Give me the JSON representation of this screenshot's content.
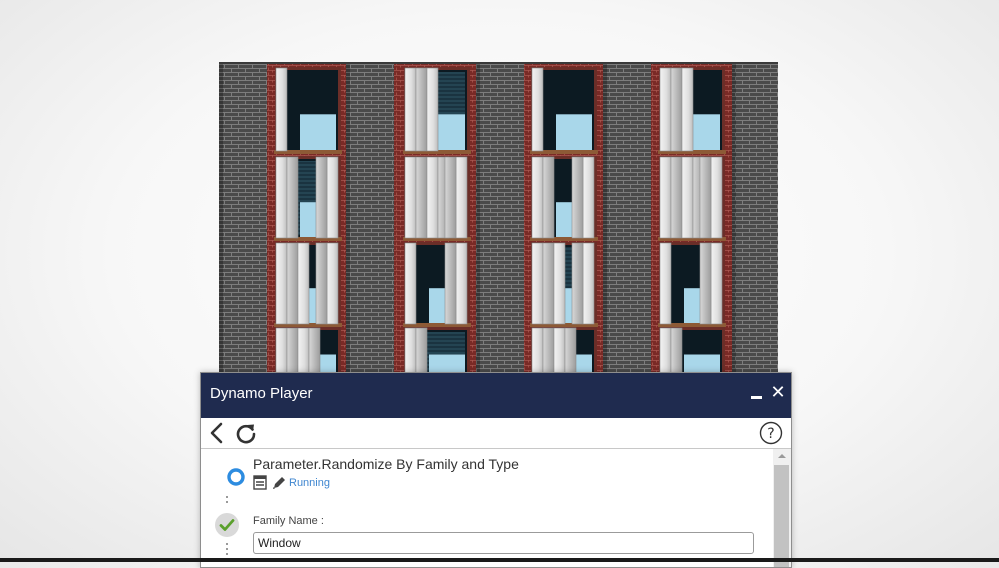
{
  "player": {
    "title": "Dynamo Player",
    "script": {
      "name": "Parameter.Randomize By Family and Type",
      "status": "Running"
    },
    "inputs": {
      "family_name_label": "Family Name :",
      "family_name_value": "Window"
    }
  },
  "icons": {
    "back": "chevron-left-icon",
    "refresh": "refresh-icon",
    "help": "help-icon",
    "minimize": "minimize-icon",
    "close": "close-icon",
    "script_type": "script-icon",
    "edit": "pencil-icon",
    "done": "check-icon"
  },
  "colors": {
    "titlebar": "#1f2b4f",
    "status": "#3f86d0",
    "radio": "#2d8ce0",
    "check": "#5aa02c",
    "brick": "#4f4f4f",
    "window_frame": "#8a3b33",
    "glass": "#a9d7ea",
    "glass_dark": "#0c1a22"
  }
}
